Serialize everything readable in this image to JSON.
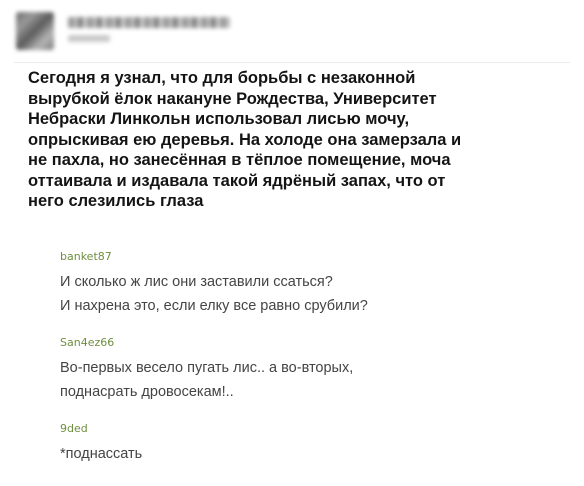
{
  "post": {
    "text": "Сегодня я узнал, что для борьбы с незаконной\nвырубкой ёлок накануне Рождества, Университет\nНебраски Линкольн использовал лисью мочу,\nопрыскивая ею деревья. На холоде она замерзала и\nне пахла, но занесённая в тёплое помещение, моча\nоттаивала и издавала такой ядрёный запах, что от\nнего слезились глаза"
  },
  "comments": [
    {
      "author": "banket87",
      "text": "И сколько ж лис они заставили ссаться?\nИ нахрена это, если елку все равно срубили?"
    },
    {
      "author": "San4ez66",
      "text": "Во-первых весело пугать лис.. а во-вторых,\nподнасрать дровосекам!.."
    },
    {
      "author": "9ded",
      "text": "*поднассать"
    }
  ],
  "colors": {
    "comment_author": "#6f8f3f",
    "comment_text": "#444444",
    "post_text": "#141414"
  },
  "icons": {
    "avatar": "blurred-avatar-image"
  }
}
